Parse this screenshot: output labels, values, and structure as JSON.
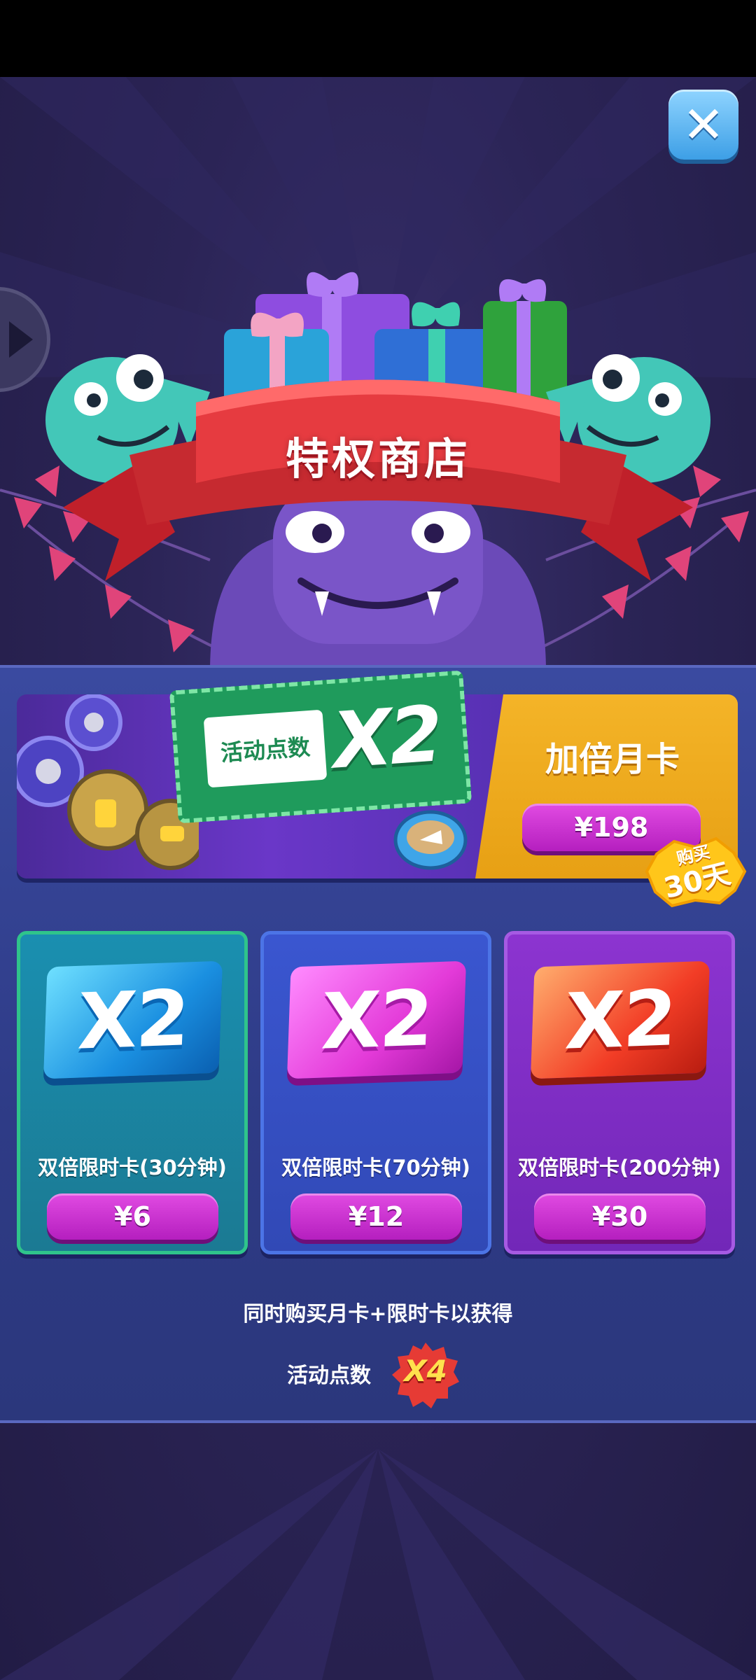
{
  "header": {
    "close_icon": "close-icon",
    "side_arrow_icon": "play-arrow-icon"
  },
  "title": "特权商店",
  "monthly_card": {
    "ticket_label": "活动点数",
    "ticket_multiplier": "X2",
    "title": "加倍月卡",
    "price": "¥198",
    "badge_line1": "购买",
    "badge_line2": "30天"
  },
  "timed_cards": [
    {
      "multiplier": "X2",
      "label": "双倍限时卡(30分钟)",
      "price": "¥6",
      "color": "#1a8fb0"
    },
    {
      "multiplier": "X2",
      "label": "双倍限时卡(70分钟)",
      "price": "¥12",
      "color": "#3a56d0"
    },
    {
      "multiplier": "X2",
      "label": "双倍限时卡(200分钟)",
      "price": "¥30",
      "color": "#8c34d0"
    }
  ],
  "combo": {
    "text": "同时购买月卡+限时卡以获得",
    "points_label": "活动点数",
    "multiplier": "X4"
  },
  "colors": {
    "accent_purple": "#b51fbf",
    "gold": "#f4b428",
    "panel_blue": "#2e3b86"
  }
}
